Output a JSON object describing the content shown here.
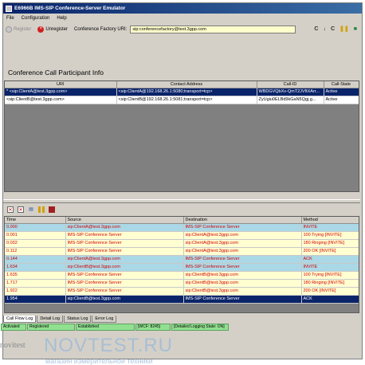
{
  "window": {
    "title": "E6966B IMS-SIP Conference-Server Emulator"
  },
  "menu": [
    "File",
    "Configuration",
    "Help"
  ],
  "toolbar": {
    "register": "Register",
    "unregister": "Unregister",
    "cf_label": "Conference Factory URI:",
    "cf_value": "sip:conferencefactory@test.3gpp.com"
  },
  "participants": {
    "title": "Conference Call Participant Info",
    "columns": [
      "URI",
      "Contact Address",
      "Call-ID",
      "Call-State"
    ],
    "rows": [
      [
        "* <sip:ClientA@test.3gpp.com>",
        "<sip:ClientA@192.168.26.1:5080;transport=tcp>",
        "WBDGVQbXv-QmT2JVftXArr...",
        "Active"
      ],
      [
        "<sip:ClientB@test.3gpp.com>",
        "<sip:ClientB@192.168.26.1:5081;transport=tcp>",
        "ZyUgiu0ELBd9kGaN5Qgj.g...",
        "Active"
      ]
    ]
  },
  "call_log": {
    "columns": [
      "Time",
      "Source",
      "Destination",
      "Method"
    ],
    "rows": [
      {
        "time": "0.000",
        "source": "sip:ClientA@test.3gpp.com",
        "destination": "IMS-SIP Conference Server",
        "method": "INVITE",
        "style": "blue"
      },
      {
        "time": "0.001",
        "source": "IMS-SIP Conference Server",
        "destination": "sip:ClientA@test.3gpp.com",
        "method": "100 Trying  [INVITE]",
        "style": "yellow"
      },
      {
        "time": "0.032",
        "source": "IMS-SIP Conference Server",
        "destination": "sip:ClientA@test.3gpp.com",
        "method": "180 Ringing  [INVITE]",
        "style": "yellow"
      },
      {
        "time": "0.112",
        "source": "IMS-SIP Conference Server",
        "destination": "sip:ClientA@test.3gpp.com",
        "method": "200 OK  [INVITE]",
        "style": "yellow"
      },
      {
        "time": "0.144",
        "source": "sip:ClientA@test.3gpp.com",
        "destination": "IMS-SIP Conference Server",
        "method": "ACK",
        "style": "blue"
      },
      {
        "time": "1.634",
        "source": "sip:ClientB@test.3gpp.com",
        "destination": "IMS-SIP Conference Server",
        "method": "INVITE",
        "style": "blue"
      },
      {
        "time": "1.635",
        "source": "IMS-SIP Conference Server",
        "destination": "sip:ClientB@test.3gpp.com",
        "method": "100 Trying  [INVITE]",
        "style": "yellow"
      },
      {
        "time": "1.717",
        "source": "IMS-SIP Conference Server",
        "destination": "sip:ClientB@test.3gpp.com",
        "method": "180 Ringing  [INVITE]",
        "style": "yellow"
      },
      {
        "time": "1.922",
        "source": "IMS-SIP Conference Server",
        "destination": "sip:ClientB@test.3gpp.com",
        "method": "200 OK  [INVITE]",
        "style": "yellow"
      },
      {
        "time": "1.954",
        "source": "sip:ClientB@test.3gpp.com",
        "destination": "IMS-SIP Conference Server",
        "method": "ACK",
        "style": "sel"
      }
    ]
  },
  "tabs": [
    "Call Flow Log",
    "Detail Log",
    "Status Log",
    "Error Log"
  ],
  "status": [
    "Activated",
    "Registered",
    "Established",
    "[WCF: 8245]",
    "[Detailed Logging State: ON]"
  ],
  "watermark": {
    "logo": "novitest",
    "main": "NOVTEST.RU",
    "sub": "магазин измерительной техники"
  },
  "colors": {
    "title_bar": "#0a246a",
    "selected_row": "#0a246a",
    "request_row": "#aad8e6",
    "response_row": "#ffffd2",
    "log_text": "#d80000",
    "status_ok": "#90e090",
    "cf_input_bg": "#ffffcc"
  },
  "icons": {
    "register": "register-icon",
    "unregister": "unregister-icon",
    "clear_log": "clear-log-icon",
    "pause": "pause-icon",
    "stop": "stop-icon"
  }
}
